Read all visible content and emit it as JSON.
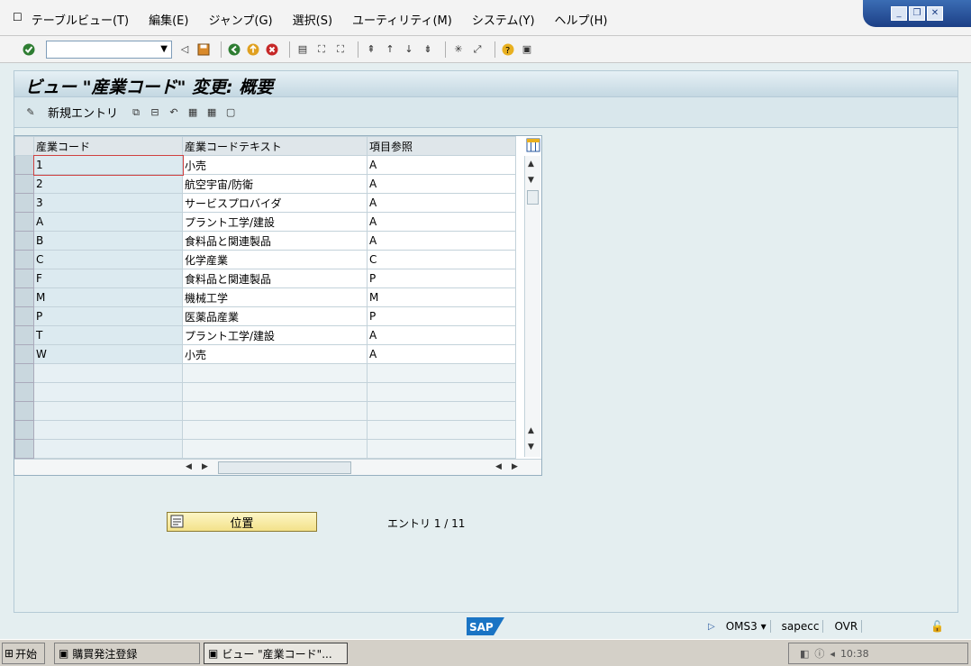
{
  "menubar": {
    "icon": "window-menu-icon",
    "items": [
      "テーブルビュー(T)",
      "編集(E)",
      "ジャンプ(G)",
      "選択(S)",
      "ユーティリティ(M)",
      "システム(Y)",
      "ヘルプ(H)"
    ]
  },
  "window_controls": {
    "minimize": "_",
    "restore": "❐",
    "close": "✕"
  },
  "toolbar": {
    "command_field_value": ""
  },
  "title": "ビュー \"産業コード\" 変更: 概要",
  "app_toolbar": {
    "new_entry_label": "新規エントリ"
  },
  "table": {
    "headers": [
      "産業コード",
      "産業コードテキスト",
      "項目参照"
    ],
    "rows": [
      [
        "1",
        "小売",
        "A"
      ],
      [
        "2",
        "航空宇宙/防衛",
        "A"
      ],
      [
        "3",
        "サービスプロバイダ",
        "A"
      ],
      [
        "A",
        "プラント工学/建設",
        "A"
      ],
      [
        "B",
        "食料品と関連製品",
        "A"
      ],
      [
        "C",
        "化学産業",
        "C"
      ],
      [
        "F",
        "食料品と関連製品",
        "P"
      ],
      [
        "M",
        "機械工学",
        "M"
      ],
      [
        "P",
        "医薬品産業",
        "P"
      ],
      [
        "T",
        "プラント工学/建設",
        "A"
      ],
      [
        "W",
        "小売",
        "A"
      ]
    ],
    "empty_rows": 5
  },
  "position_button": {
    "label": "位置"
  },
  "entry_info": "エントリ 1 / 11",
  "statusbar": {
    "logo": "SAP",
    "transaction": "OMS3",
    "server": "sapecc",
    "mode": "OVR"
  },
  "taskbar": {
    "start_label": "开始",
    "tasks": [
      "購買発注登録",
      "ビュー \"産業コード\"..."
    ],
    "tray_text": "10:38"
  }
}
